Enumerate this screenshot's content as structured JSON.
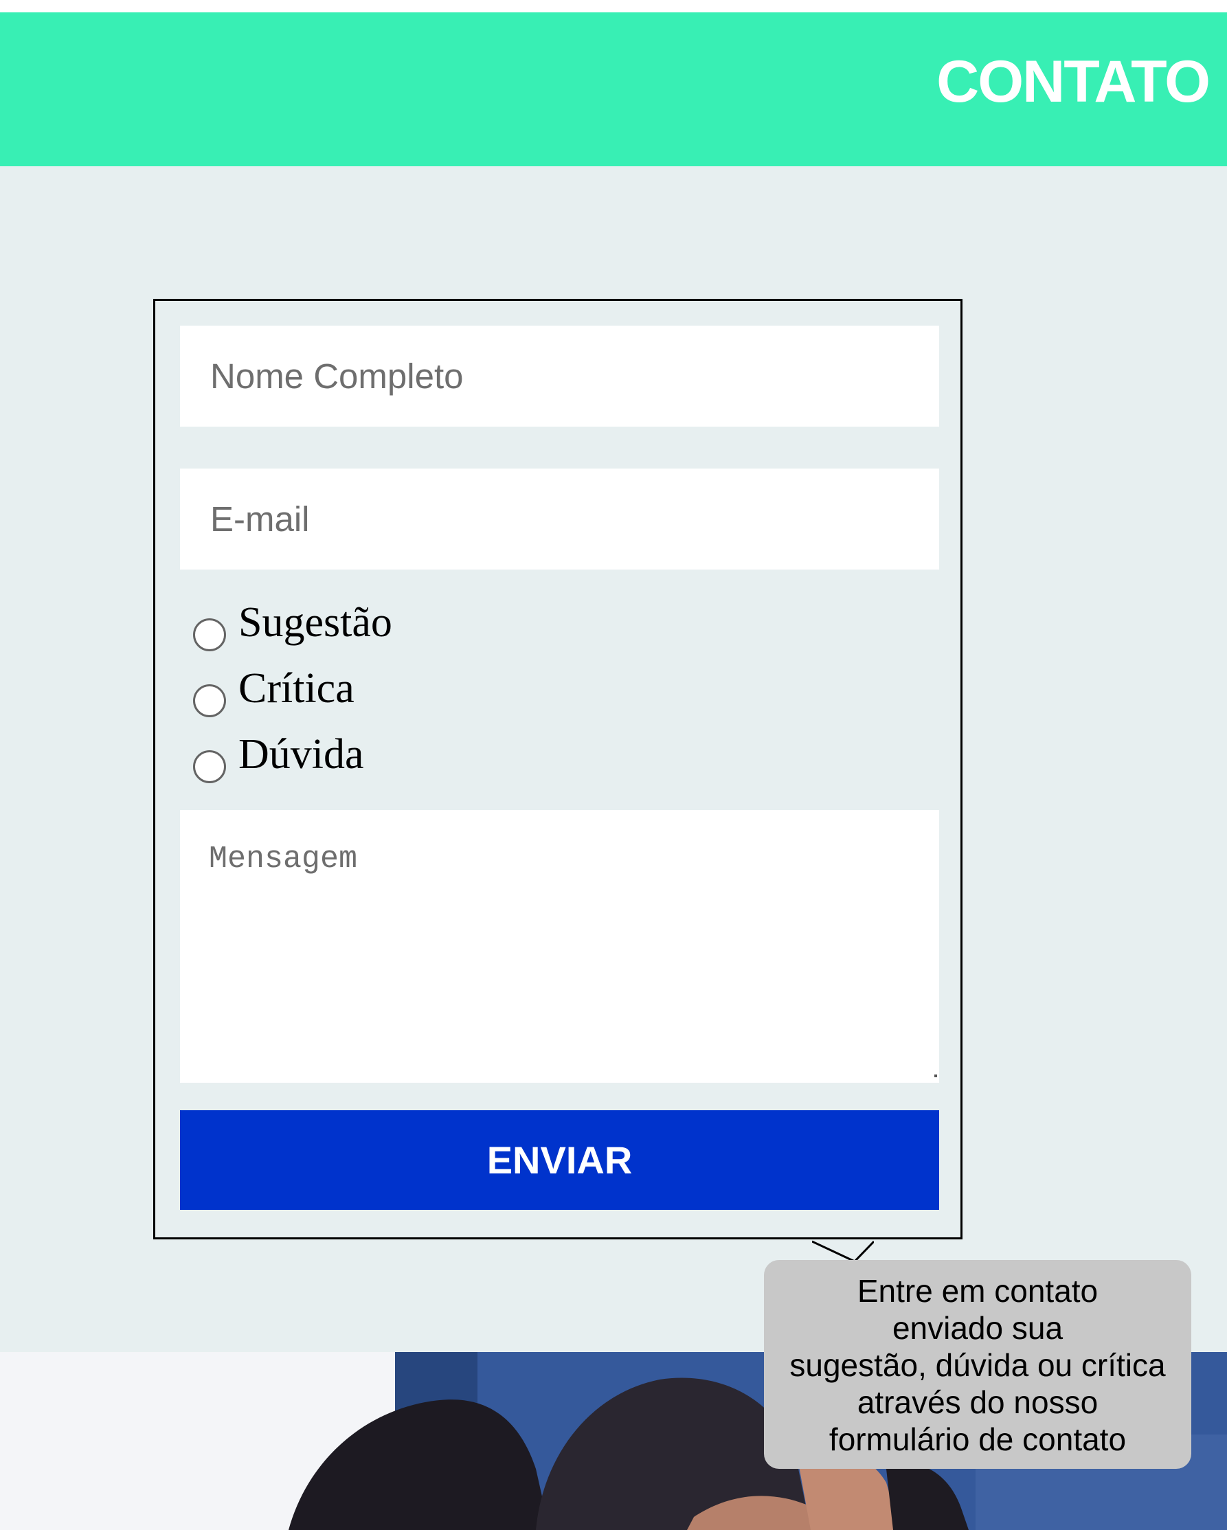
{
  "header": {
    "title": "CONTATO"
  },
  "form": {
    "name_placeholder": "Nome Completo",
    "email_placeholder": "E-mail",
    "options": [
      {
        "label": "Sugestão",
        "selected": false
      },
      {
        "label": "Crítica",
        "selected": false
      },
      {
        "label": "Dúvida",
        "selected": false
      }
    ],
    "message_placeholder": "Mensagem",
    "submit_label": "ENVIAR"
  },
  "tooltip": {
    "lines": [
      "Entre em contato",
      "enviado sua",
      "sugestão, dúvida ou crítica",
      "através do nosso",
      "formulário de contato"
    ]
  },
  "colors": {
    "header_bg": "#38efb4",
    "section_bg": "#e7eff0",
    "button_bg": "#0033cc",
    "tooltip_bg": "#c8c8c8"
  }
}
